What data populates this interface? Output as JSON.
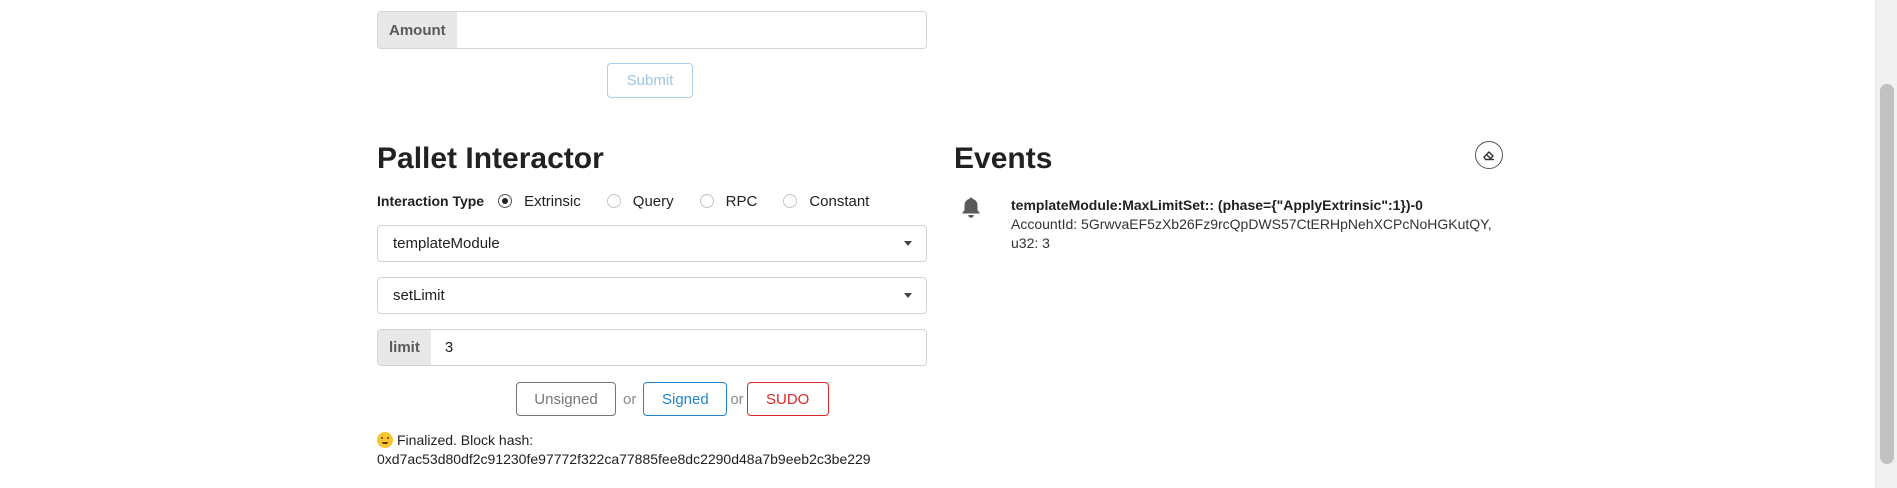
{
  "balance_transfer": {
    "amount_label": "Amount",
    "amount_value": "",
    "submit_label": "Submit"
  },
  "pallet_interactor": {
    "title": "Pallet Interactor",
    "interaction_type_label": "Interaction Type",
    "interaction_types": [
      {
        "label": "Extrinsic",
        "checked": true
      },
      {
        "label": "Query",
        "checked": false
      },
      {
        "label": "RPC",
        "checked": false
      },
      {
        "label": "Constant",
        "checked": false
      }
    ],
    "pallet_value": "templateModule",
    "callable_value": "setLimit",
    "param_label": "limit",
    "param_value": "3",
    "buttons": {
      "unsigned": "Unsigned",
      "signed": "Signed",
      "sudo": "SUDO",
      "or": "or"
    },
    "status_line1": "Finalized. Block hash:",
    "status_line2": "0xd7ac53d80df2c91230fe97772f322ca77885fee8dc2290d48a7b9eeb2c3be229"
  },
  "events": {
    "title": "Events",
    "items": [
      {
        "title": "templateModule:MaxLimitSet:: (phase={\"ApplyExtrinsic\":1})-0",
        "line1": "AccountId: 5GrwvaEF5zXb26Fz9rcQpDWS57CtERHpNehXCPcNoHGKutQY,",
        "line2": "u32: 3"
      }
    ]
  },
  "icons": {
    "clear": "eraser-icon",
    "event": "bell-icon",
    "status_emoji": "smiling-face-icon"
  },
  "colors": {
    "primary": "#2185d0",
    "danger": "#db2828",
    "submit_disabled": "#9cc6e6"
  }
}
